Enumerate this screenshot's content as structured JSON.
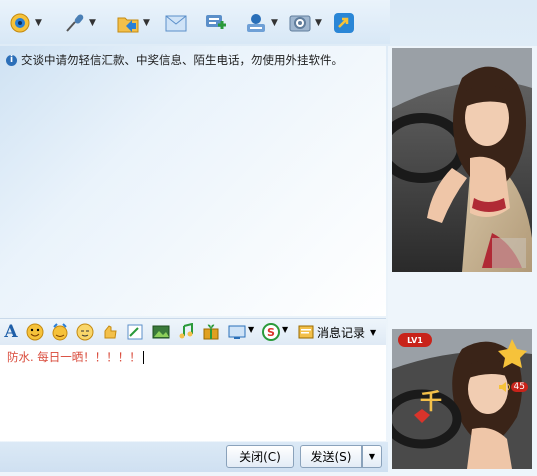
{
  "toolbar": {
    "items": [
      {
        "name": "video-call-icon",
        "color": "#2a7fd6"
      },
      {
        "name": "voice-call-icon",
        "color": "#4a7fb5"
      },
      {
        "name": "send-file-icon",
        "color": "#e0a020"
      },
      {
        "name": "email-icon",
        "color": "#5b8fc9"
      },
      {
        "name": "create-discussion-icon",
        "color": "#2a9a3a"
      },
      {
        "name": "app-center-icon",
        "color": "#2a6fb8"
      },
      {
        "name": "settings-icon",
        "color": "#607d9c"
      },
      {
        "name": "share-icon",
        "color": "#2a86d6"
      }
    ]
  },
  "notice": {
    "text": "交谈中请勿轻信汇款、中奖信息、陌生电话，勿使用外挂软件。"
  },
  "format_bar": {
    "items": [
      "font-icon",
      "emoticon-icon",
      "magic-emoticon-icon",
      "smile-face-icon",
      "shake-icon",
      "scribble-icon",
      "image-icon",
      "music-icon",
      "gift-icon",
      "screenshot-icon",
      "search-icon"
    ],
    "history_label": "消息记录"
  },
  "input": {
    "text": "防水. 每日一晒！！！！！"
  },
  "buttons": {
    "close_label": "关闭(C)",
    "send_label": "发送(S)"
  },
  "profile": {
    "level_badge": "LV1",
    "level_label": "45"
  },
  "colors": {
    "accent": "#2a7fd6",
    "input_text": "#d94a3a",
    "badge": "#c8231a"
  }
}
